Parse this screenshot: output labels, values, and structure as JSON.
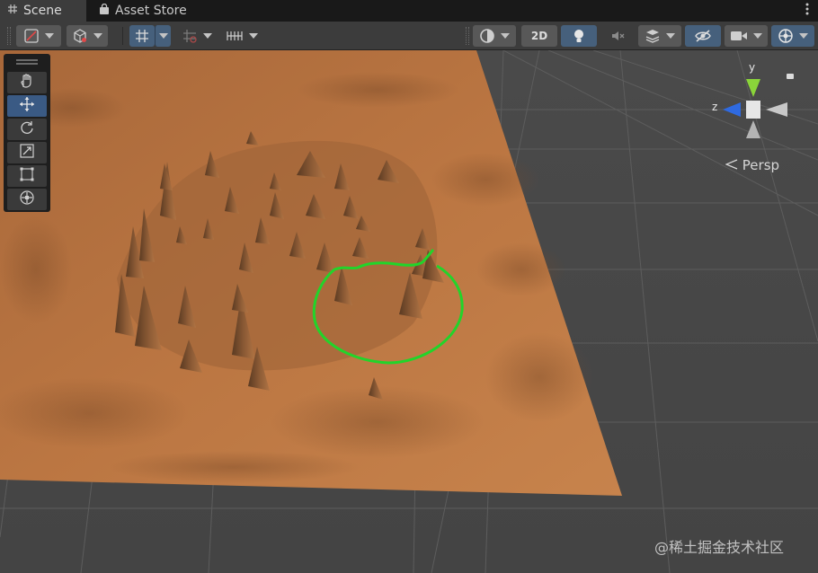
{
  "tabs": [
    {
      "label": "Scene",
      "icon": "grid-hash-icon",
      "active": true
    },
    {
      "label": "Asset Store",
      "icon": "shopping-bag-icon",
      "active": false
    }
  ],
  "toolbar": {
    "toggle_2d_label": "2D"
  },
  "tools_overlay": {
    "items": [
      "hand-tool",
      "move-tool",
      "rotate-tool",
      "scale-tool",
      "rect-tool",
      "transform-tool"
    ],
    "selected": "move-tool"
  },
  "gizmo": {
    "y_label": "y",
    "z_label": "z",
    "projection_label": "Persp"
  },
  "brush": {
    "color": "#22d42a"
  },
  "colors": {
    "terrain": "#b5703e",
    "grid_background": "#474747",
    "selected_button": "#46607c"
  },
  "watermark": "@稀土掘金技术社区"
}
